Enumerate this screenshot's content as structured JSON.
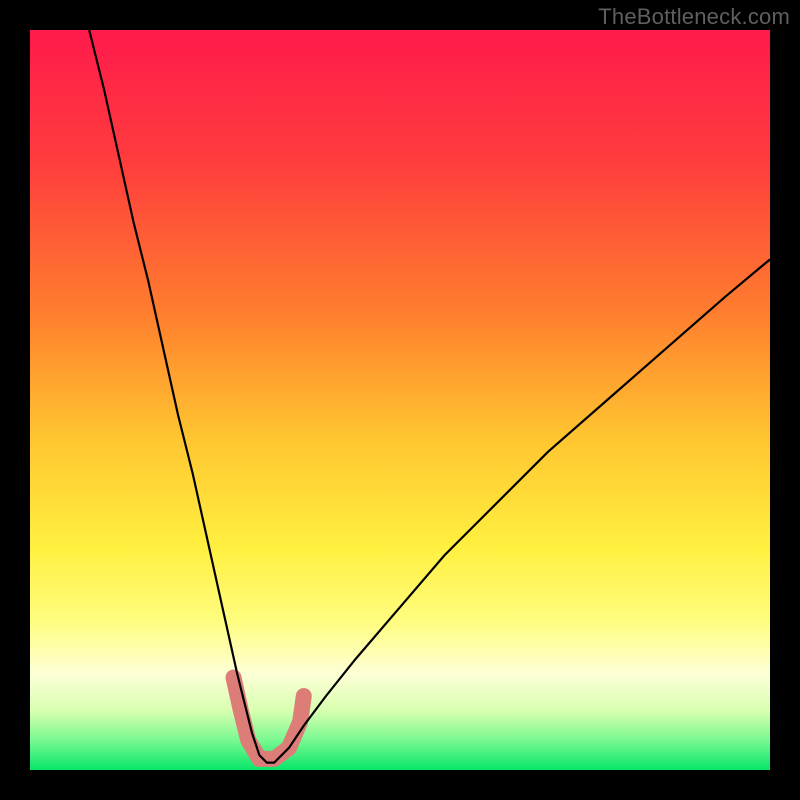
{
  "watermark": "TheBottleneck.com",
  "chart_data": {
    "type": "line",
    "title": "",
    "xlabel": "",
    "ylabel": "",
    "xlim": [
      0,
      100
    ],
    "ylim": [
      0,
      100
    ],
    "grid": false,
    "legend": false,
    "background_gradient_stops": [
      {
        "offset": 0.0,
        "color": "#ff1a4b"
      },
      {
        "offset": 0.18,
        "color": "#ff3d3d"
      },
      {
        "offset": 0.38,
        "color": "#ff7d2e"
      },
      {
        "offset": 0.55,
        "color": "#ffc530"
      },
      {
        "offset": 0.7,
        "color": "#fff040"
      },
      {
        "offset": 0.8,
        "color": "#fffd80"
      },
      {
        "offset": 0.87,
        "color": "#fdffd6"
      },
      {
        "offset": 0.92,
        "color": "#d8ffb0"
      },
      {
        "offset": 0.96,
        "color": "#78f890"
      },
      {
        "offset": 1.0,
        "color": "#08e66a"
      }
    ],
    "series": [
      {
        "name": "bottleneck-curve",
        "type": "line",
        "color": "#000000",
        "x": [
          8,
          10,
          12,
          14,
          16,
          18,
          20,
          22,
          24,
          26,
          28,
          29,
          30,
          31,
          32,
          33,
          34,
          35,
          37,
          40,
          44,
          50,
          56,
          62,
          70,
          78,
          86,
          94,
          100
        ],
        "y": [
          100,
          92,
          83,
          74,
          66,
          57,
          48,
          40,
          31,
          22,
          13,
          9,
          5,
          2,
          1,
          1,
          2,
          3,
          6,
          10,
          15,
          22,
          29,
          35,
          43,
          50,
          57,
          64,
          69
        ]
      },
      {
        "name": "highlight-band",
        "type": "line",
        "color": "#dd7d78",
        "stroke_width": 16,
        "x": [
          27.5,
          28.5,
          29.5,
          31.0,
          33.0,
          35.0,
          36.5,
          37.0
        ],
        "y": [
          12.5,
          8.0,
          4.0,
          1.5,
          1.5,
          3.0,
          6.5,
          10.0
        ]
      }
    ],
    "annotations": []
  }
}
